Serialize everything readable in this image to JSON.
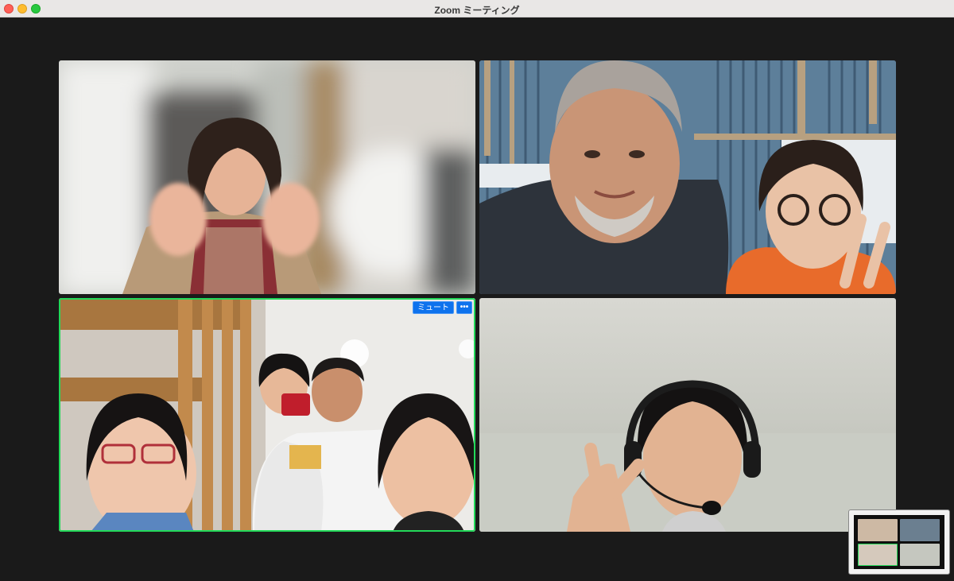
{
  "window": {
    "title": "Zoom ミーティング"
  },
  "gallery": {
    "participants": [
      {
        "id": "participant-1",
        "active_speaker": false
      },
      {
        "id": "participant-2",
        "active_speaker": false
      },
      {
        "id": "participant-3",
        "active_speaker": true
      },
      {
        "id": "participant-4",
        "active_speaker": false
      }
    ]
  },
  "tile_controls": {
    "mute_label": "ミュート",
    "more_label": "•••"
  },
  "colors": {
    "active_speaker_border": "#23d959",
    "button_blue": "#0e72ed",
    "stage_background": "#1a1a1a"
  }
}
